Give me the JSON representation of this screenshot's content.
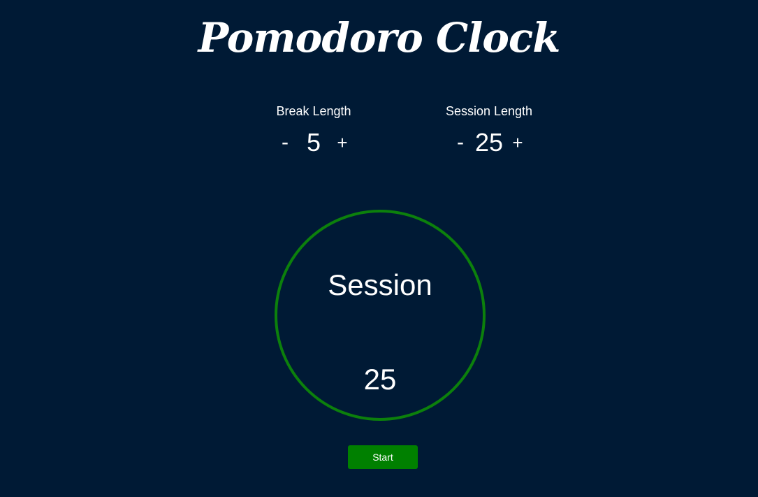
{
  "app": {
    "title": "Pomodoro Clock"
  },
  "break_control": {
    "label": "Break Length",
    "decrement": "-",
    "value": "5",
    "increment": "+"
  },
  "session_control": {
    "label": "Session Length",
    "decrement": "-",
    "value": "25",
    "increment": "+"
  },
  "timer": {
    "label": "Session",
    "time": "25"
  },
  "actions": {
    "start_label": "Start"
  },
  "colors": {
    "background": "#001a35",
    "ring": "#0c800c",
    "start_button": "#008000",
    "text": "#ffffff"
  }
}
